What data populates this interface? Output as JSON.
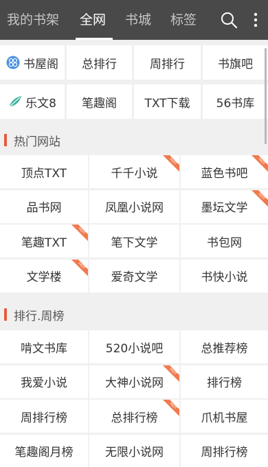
{
  "nav": {
    "tabs": [
      "我的书架",
      "全网",
      "书城",
      "标签"
    ],
    "active_index": 1,
    "search_icon": "search-icon",
    "more_icon": "more-vertical-icon"
  },
  "quick_links": [
    {
      "label": "书屋阁",
      "icon": "flower-icon",
      "icon_color": "#4a90e2"
    },
    {
      "label": "总排行"
    },
    {
      "label": "周排行"
    },
    {
      "label": "书旗吧"
    },
    {
      "label": "乐文8",
      "icon": "leaf-icon",
      "icon_color": "#3bb39b"
    },
    {
      "label": "笔趣阁"
    },
    {
      "label": "TXT下载"
    },
    {
      "label": "56书库"
    }
  ],
  "sections": [
    {
      "title": "热门网站",
      "items": [
        {
          "label": "顶点TXT",
          "hot": false
        },
        {
          "label": "千千小说",
          "hot": true
        },
        {
          "label": "蓝色书吧",
          "hot": true
        },
        {
          "label": "品书网",
          "hot": false
        },
        {
          "label": "凤凰小说网",
          "hot": false
        },
        {
          "label": "墨坛文学",
          "hot": true
        },
        {
          "label": "笔趣TXT",
          "hot": true
        },
        {
          "label": "笔下文学",
          "hot": false
        },
        {
          "label": "书包网",
          "hot": false
        },
        {
          "label": "文学楼",
          "hot": true
        },
        {
          "label": "爱奇文学",
          "hot": false
        },
        {
          "label": "书快小说",
          "hot": false
        }
      ]
    },
    {
      "title": "排行.周榜",
      "items": [
        {
          "label": "啃文书库",
          "hot": false
        },
        {
          "label": "520小说吧",
          "hot": false
        },
        {
          "label": "总推荐榜",
          "hot": false
        },
        {
          "label": "我爱小说",
          "hot": false
        },
        {
          "label": "大神小说网",
          "hot": true
        },
        {
          "label": "排行榜",
          "hot": false
        },
        {
          "label": "周排行榜",
          "hot": false
        },
        {
          "label": "总排行榜",
          "hot": true
        },
        {
          "label": "爪机书屋",
          "hot": false
        },
        {
          "label": "笔趣阁月榜",
          "hot": false
        },
        {
          "label": "无限小说网",
          "hot": false
        },
        {
          "label": "周排行榜",
          "hot": false
        }
      ]
    }
  ],
  "hot_badge": {
    "text": "HOT",
    "color": "#f07a4e"
  },
  "colors": {
    "topbar": "#494949",
    "accent": "#e35c3c",
    "background": "#f0f0f0"
  }
}
